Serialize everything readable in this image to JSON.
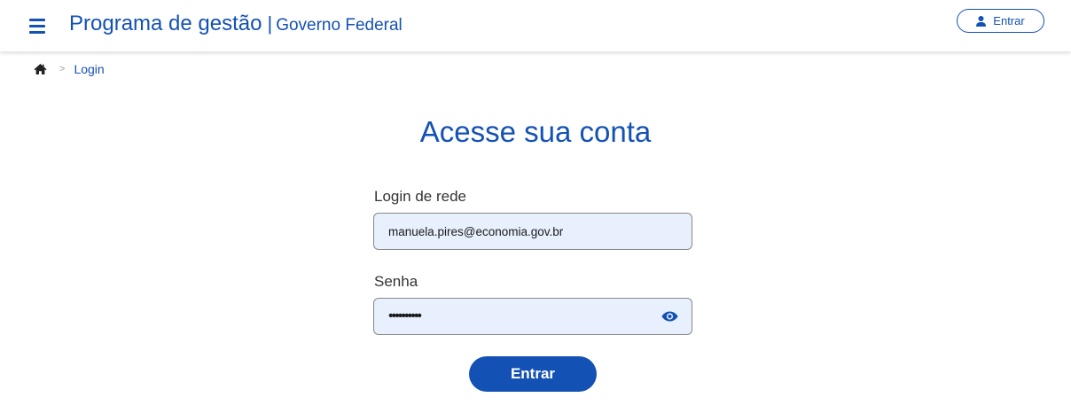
{
  "header": {
    "menu_icon": "hamburger-menu-icon",
    "app_title": "Programa de gestão",
    "separator": "|",
    "org_name": "Governo Federal",
    "login_button_label": "Entrar",
    "login_button_icon": "user-icon"
  },
  "breadcrumb": {
    "home_icon": "home-icon",
    "separator": ">",
    "current": "Login"
  },
  "login_form": {
    "title": "Acesse sua conta",
    "username_label": "Login de rede",
    "username_value": "manuela.pires@economia.gov.br",
    "password_label": "Senha",
    "password_value": "••••••••••",
    "show_password_icon": "eye-icon",
    "submit_label": "Entrar"
  },
  "colors": {
    "primary": "#1351b4",
    "input_background": "#e8f0fe",
    "label_text": "#333333"
  }
}
